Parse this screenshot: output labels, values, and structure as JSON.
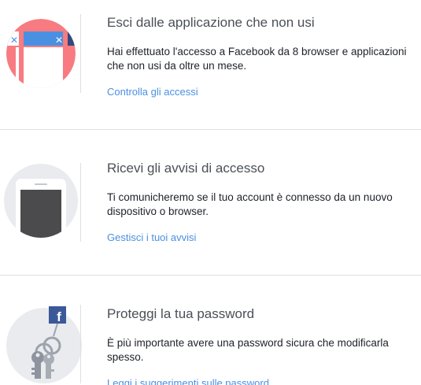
{
  "sections": [
    {
      "title": "Esci dalle applicazione che non usi",
      "description": "Hai effettuato l'accesso a Facebook da 8 browser e applicazioni che non usi da oltre un mese.",
      "link": "Controlla gli accessi",
      "icon": "browser-sessions-icon"
    },
    {
      "title": "Ricevi gli avvisi di accesso",
      "description": "Ti comunicheremo se il tuo account è connesso da un nuovo dispositivo o browser.",
      "link": "Gestisci i tuoi avvisi",
      "icon": "phone-icon"
    },
    {
      "title": "Proteggi la tua password",
      "description": "È più importante avere una password sicura che modificarla spesso.",
      "link": "Leggi i suggerimenti sulle password",
      "icon": "keys-icon"
    }
  ],
  "colors": {
    "link": "#4a90e2",
    "title": "#4b4f56",
    "text": "#1d2129",
    "divider": "#dddfe2",
    "circle": "#e9ebee",
    "pink": "#f77b80",
    "blue": "#4a90e2",
    "facebook": "#3b5998"
  }
}
